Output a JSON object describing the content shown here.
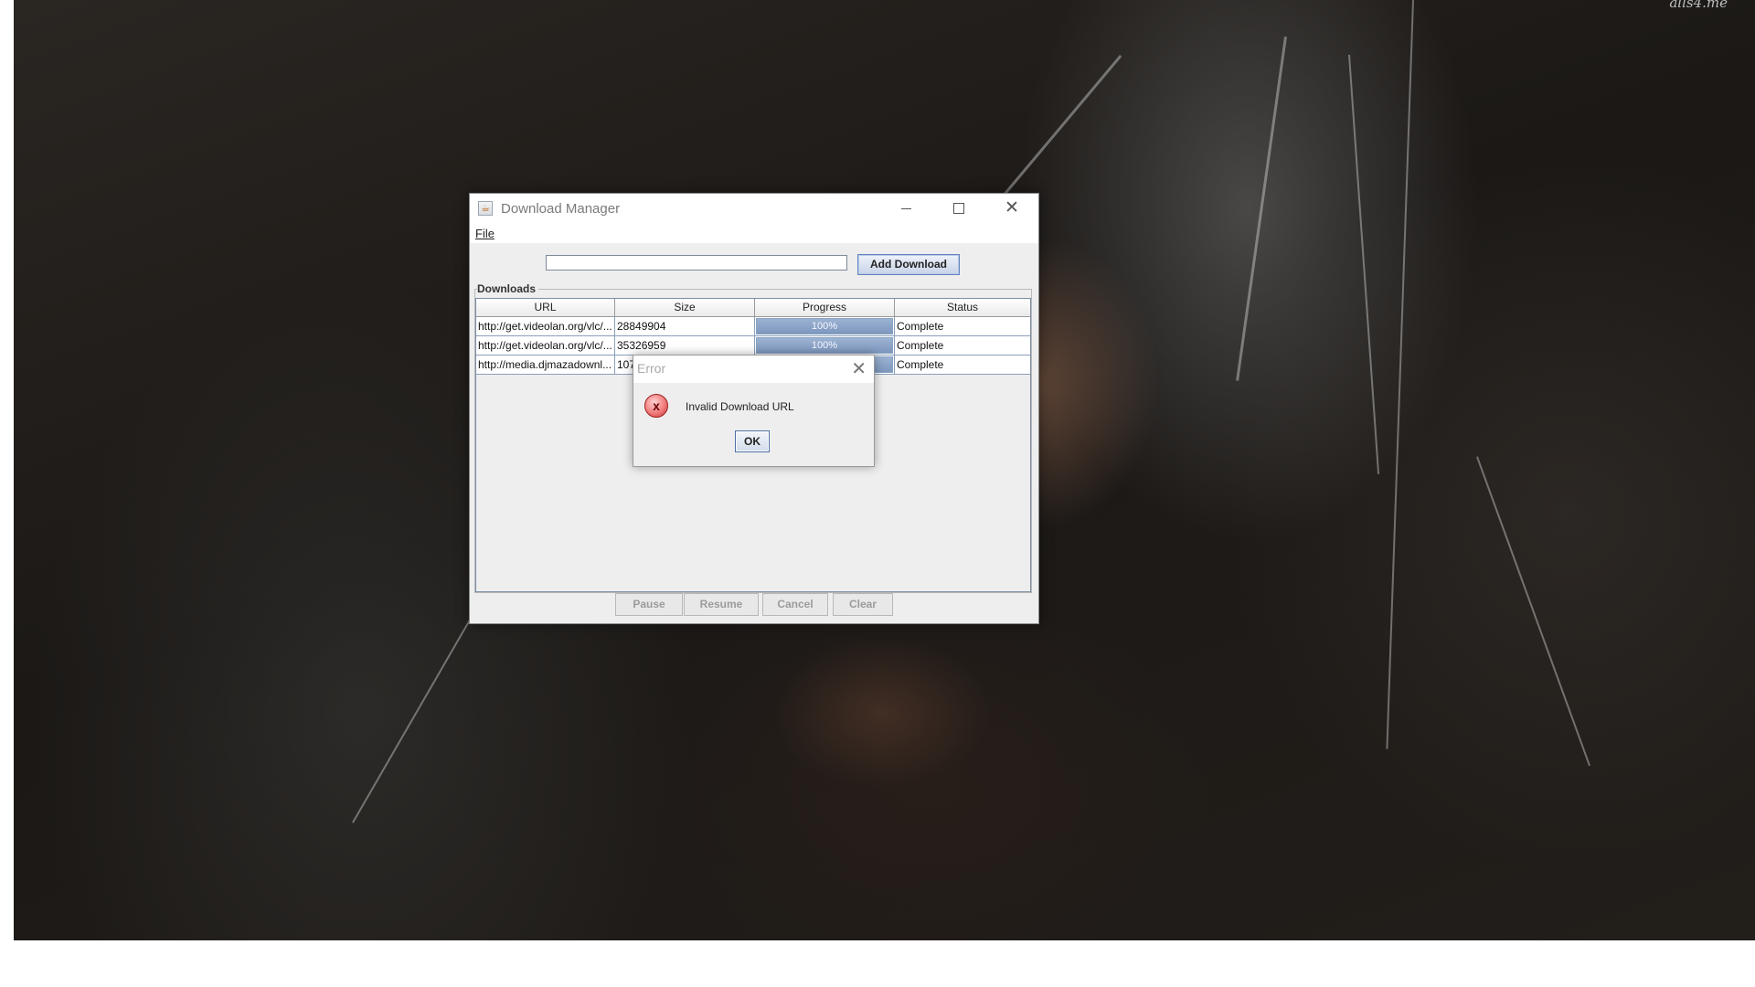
{
  "desktop": {
    "watermark": "alls4.me"
  },
  "window": {
    "title": "Download Manager",
    "icon": "java-app-icon",
    "controls": {
      "minimize": "minimize-icon",
      "maximize": "maximize-icon",
      "close": "close-icon"
    }
  },
  "menu": {
    "file": "File"
  },
  "toolbar": {
    "url_value": "",
    "add_label": "Add Download"
  },
  "downloads": {
    "section_label": "Downloads",
    "columns": [
      "URL",
      "Size",
      "Progress",
      "Status"
    ],
    "rows": [
      {
        "url": "http://get.videolan.org/vlc/...",
        "size": "28849904",
        "progress_text": "100%",
        "progress": 1.0,
        "status": "Complete"
      },
      {
        "url": "http://get.videolan.org/vlc/...",
        "size": "35326959",
        "progress_text": "100%",
        "progress": 1.0,
        "status": "Complete"
      },
      {
        "url": "http://media.djmazadownl...",
        "size": "107",
        "progress_text": "",
        "progress": 1.0,
        "status": "Complete"
      }
    ]
  },
  "actions": {
    "pause": "Pause",
    "resume": "Resume",
    "cancel": "Cancel",
    "clear": "Clear"
  },
  "dialog": {
    "title": "Error",
    "message": "Invalid Download URL",
    "ok_label": "OK",
    "icon": "error-icon",
    "icon_glyph": "x",
    "close_glyph": "✕"
  },
  "colors": {
    "progress_fill": "#7d97bd",
    "accent_button_border": "#6382bf",
    "error_icon": "#f07c7c"
  }
}
